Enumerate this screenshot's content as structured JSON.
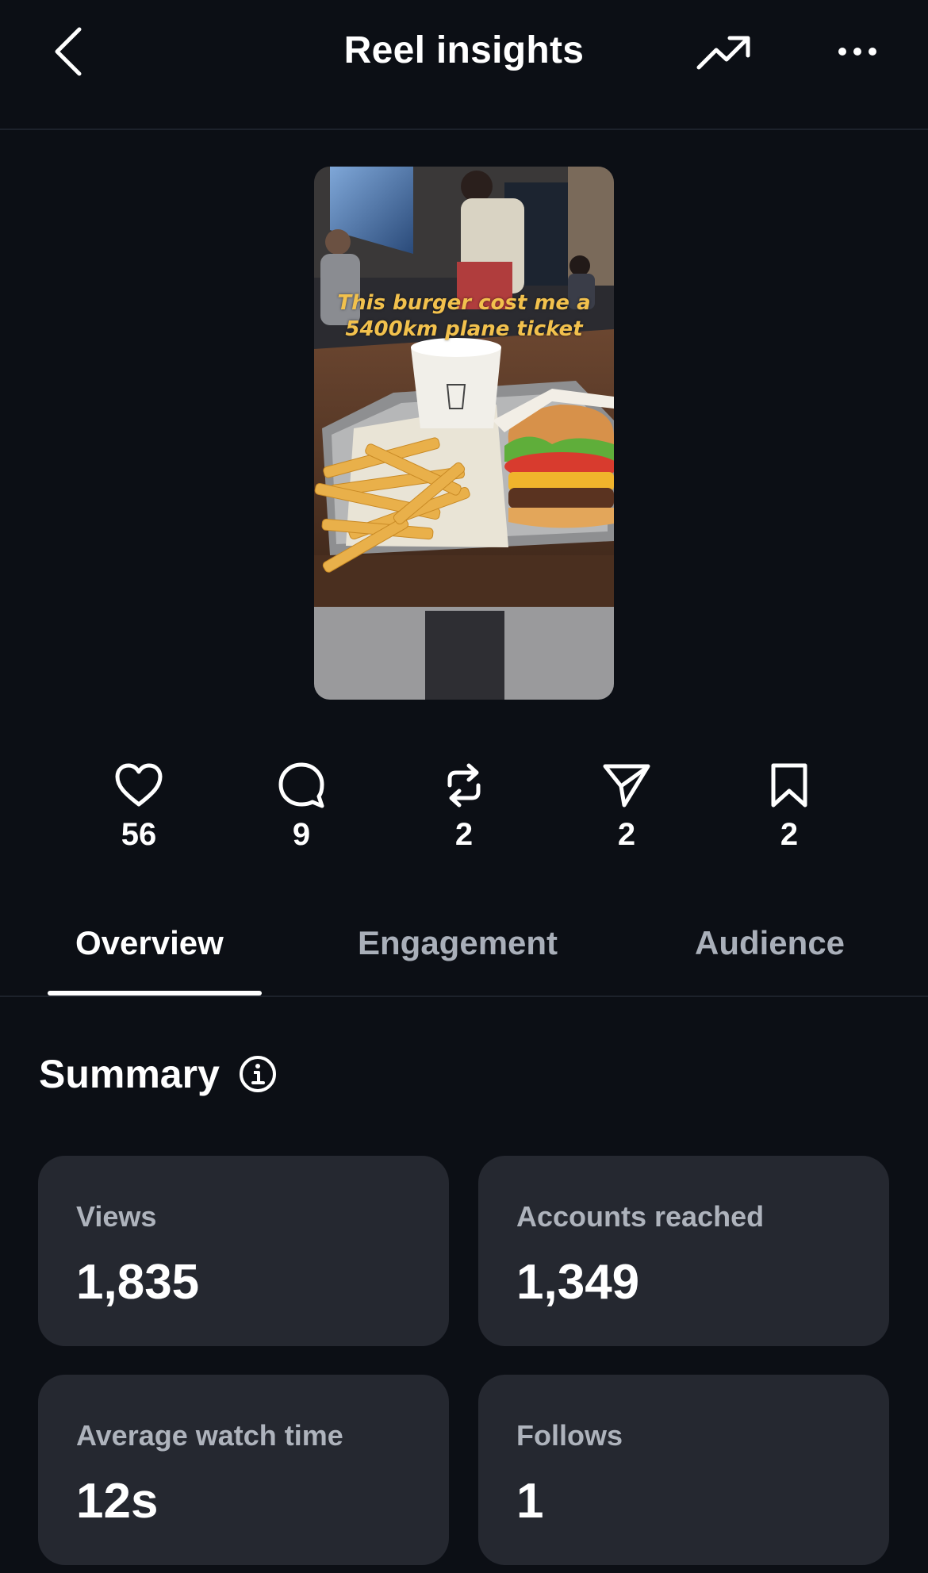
{
  "header": {
    "title": "Reel insights",
    "back_icon": "chevron-left-icon",
    "trend_icon": "trending-up-icon",
    "more_icon": "more-horizontal-icon"
  },
  "thumbnail": {
    "caption_line1": "This burger cost me a",
    "caption_line2": "5400km plane ticket"
  },
  "stats": [
    {
      "icon": "heart-icon",
      "value": "56"
    },
    {
      "icon": "comment-icon",
      "value": "9"
    },
    {
      "icon": "repost-icon",
      "value": "2"
    },
    {
      "icon": "send-icon",
      "value": "2"
    },
    {
      "icon": "bookmark-icon",
      "value": "2"
    }
  ],
  "tabs": [
    {
      "label": "Overview",
      "active": true
    },
    {
      "label": "Engagement",
      "active": false
    },
    {
      "label": "Audience",
      "active": false
    }
  ],
  "summary": {
    "title": "Summary",
    "info_icon": "info-icon",
    "cards": [
      {
        "label": "Views",
        "value": "1,835"
      },
      {
        "label": "Accounts reached",
        "value": "1,349"
      },
      {
        "label": "Average watch time",
        "value": "12s"
      },
      {
        "label": "Follows",
        "value": "1"
      }
    ]
  },
  "colors": {
    "background": "#0c0f15",
    "card": "#252830",
    "muted_text": "#aeb3bc",
    "caption": "#f2c14d"
  }
}
